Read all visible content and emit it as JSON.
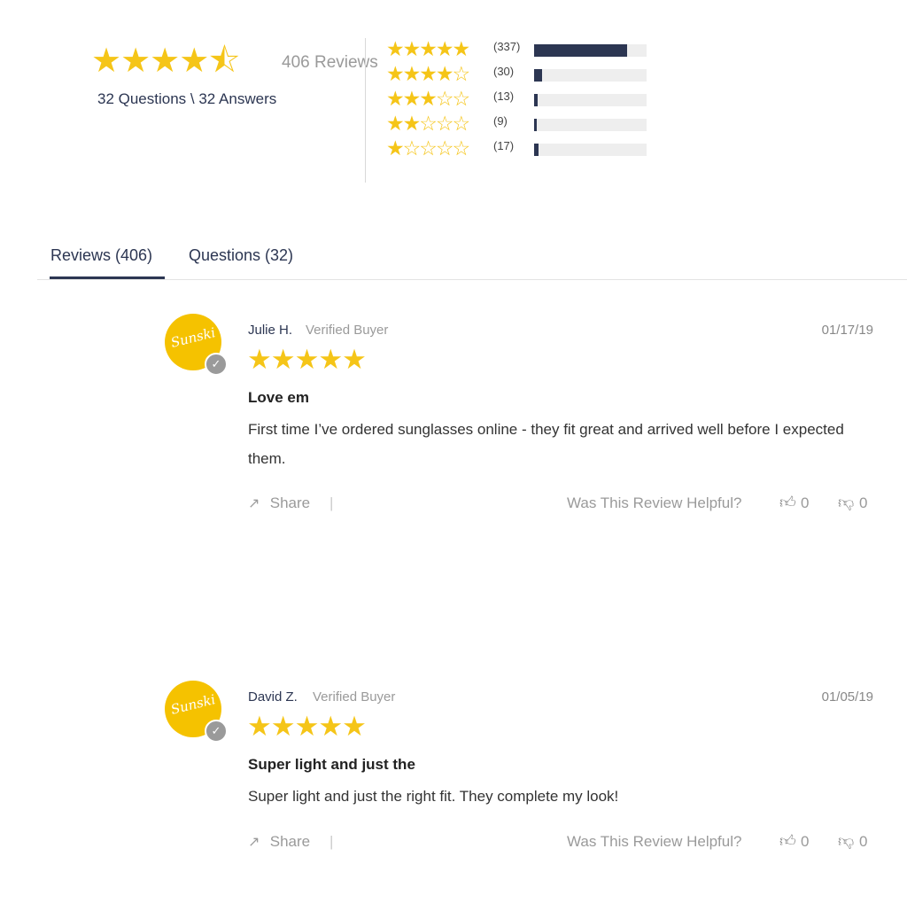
{
  "summary": {
    "stars": "★★★★⯪",
    "total_reviews": "406 Reviews",
    "qa": "32 Questions \\ 32 Answers",
    "average_rating": 4.5
  },
  "histogram": [
    {
      "stars": "★★★★★",
      "count": "(337)",
      "value": 337
    },
    {
      "stars": "★★★★☆",
      "count": "(30)",
      "value": 30
    },
    {
      "stars": "★★★☆☆",
      "count": "(13)",
      "value": 13
    },
    {
      "stars": "★★☆☆☆",
      "count": "(9)",
      "value": 9
    },
    {
      "stars": "★☆☆☆☆",
      "count": "(17)",
      "value": 17
    }
  ],
  "tabs": [
    {
      "label": "Reviews (406)",
      "active": true
    },
    {
      "label": "Questions (32)",
      "active": false
    }
  ],
  "reviews": [
    {
      "avatar_text": "Sunski",
      "name": "Julie H.",
      "verified": "Verified Buyer",
      "date": "01/17/19",
      "stars": "★★★★★",
      "title": "Love em",
      "body": "First time I’ve ordered sunglasses online - they fit great and arrived well before I expected them.",
      "share": "Share",
      "separator": "|",
      "helpful_label": "Was This Review Helpful?",
      "up": "0",
      "down": "0"
    },
    {
      "avatar_text": "Sunski",
      "name": "David Z.",
      "verified": "Verified Buyer",
      "date": "01/05/19",
      "stars": "★★★★★",
      "title": "Super light and just the",
      "body": "Super light and just the right fit. They complete my look!",
      "share": "Share",
      "separator": "|",
      "helpful_label": "Was This Review Helpful?",
      "up": "0",
      "down": "0"
    }
  ],
  "colors": {
    "star": "#f5c518",
    "accent": "#2c3652",
    "avatar": "#f5c200"
  },
  "icons": {
    "share": "share-icon",
    "up": "thumbs-up-icon",
    "down": "thumbs-down-icon",
    "verified": "check-badge-icon"
  }
}
